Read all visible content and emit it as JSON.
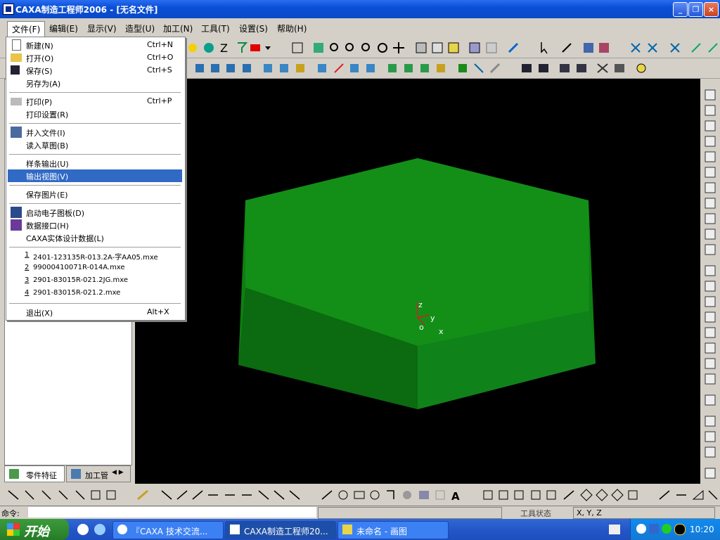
{
  "window": {
    "title": "CAXA制造工程师2006  - [无名文件]"
  },
  "menubar": [
    {
      "label": "文件(F)"
    },
    {
      "label": "编辑(E)"
    },
    {
      "label": "显示(V)"
    },
    {
      "label": "造型(U)"
    },
    {
      "label": "加工(N)"
    },
    {
      "label": "工具(T)"
    },
    {
      "label": "设置(S)"
    },
    {
      "label": "帮助(H)"
    }
  ],
  "file_menu": {
    "items": [
      {
        "label": "新建(N)",
        "shortcut": "Ctrl+N"
      },
      {
        "label": "打开(O)",
        "shortcut": "Ctrl+O"
      },
      {
        "label": "保存(S)",
        "shortcut": "Ctrl+S"
      },
      {
        "label": "另存为(A)",
        "shortcut": ""
      },
      {
        "label": "打印(P)",
        "shortcut": "Ctrl+P"
      },
      {
        "label": "打印设置(R)",
        "shortcut": ""
      },
      {
        "label": "并入文件(I)",
        "shortcut": ""
      },
      {
        "label": "读入草图(B)",
        "shortcut": ""
      },
      {
        "label": "样条输出(U)",
        "shortcut": ""
      },
      {
        "label": "输出视图(V)",
        "shortcut": ""
      },
      {
        "label": "保存图片(E)",
        "shortcut": ""
      },
      {
        "label": "启动电子图板(D)",
        "shortcut": ""
      },
      {
        "label": "数据接口(H)",
        "shortcut": ""
      },
      {
        "label": "CAXA实体设计数据(L)",
        "shortcut": ""
      },
      {
        "label": "2401-123135R-013.2A-字AA05.mxe",
        "num": "1"
      },
      {
        "label": "99000410071R-014A.mxe",
        "num": "2"
      },
      {
        "label": "2901-83015R-021.2JG.mxe",
        "num": "3"
      },
      {
        "label": "2901-83015R-021.2.mxe",
        "num": "4"
      },
      {
        "label": "退出(X)",
        "shortcut": "Alt+X"
      }
    ]
  },
  "left_tabs": [
    {
      "label": "零件特征"
    },
    {
      "label": "加工管"
    }
  ],
  "viewport": {
    "axis_z": "z",
    "axis_y": "y",
    "axis_x": "x",
    "axis_o": "o"
  },
  "command": {
    "prompt": "命令:"
  },
  "status": {
    "tool_state": "工具状态",
    "coords": "X, Y, Z"
  },
  "taskbar": {
    "start": "开始",
    "tasks": [
      {
        "label": "『CAXA 技术交流..."
      },
      {
        "label": "CAXA制造工程师20..."
      },
      {
        "label": "未命名 - 画图"
      }
    ],
    "clock": "10:20"
  },
  "colors": {
    "title_blue": "#0a4fd6",
    "highlight": "#316ac5",
    "model_green": "#0f8a14",
    "viewport_bg": "#000000"
  }
}
